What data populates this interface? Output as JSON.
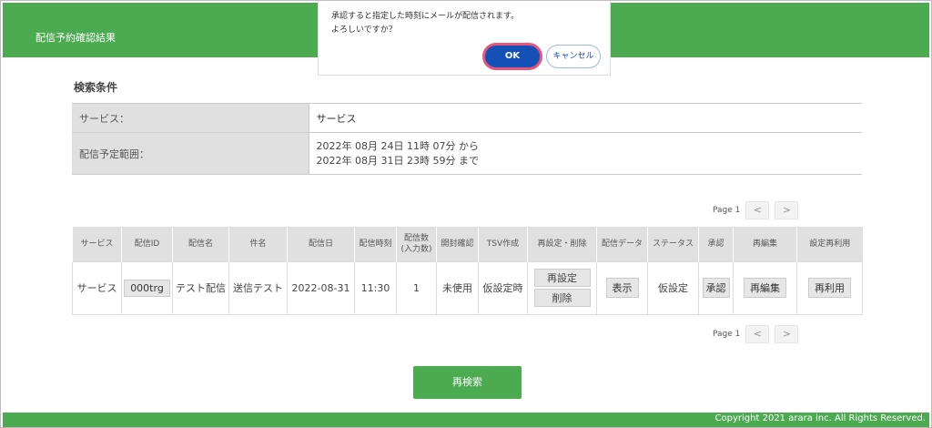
{
  "header": {
    "title": "配信予約確認結果"
  },
  "dialog": {
    "message_line1": "承認すると指定した時刻にメールが配信されます。",
    "message_line2": "よろしいですか？",
    "ok_label": "OK",
    "cancel_label": "キャンセル"
  },
  "conditions": {
    "title": "検索条件",
    "service_label": "サービス：",
    "service_value": "サービス",
    "range_label": "配信予定範囲：",
    "range_from": "2022年 08月 24日 11時 07分 から",
    "range_to": "2022年 08月 31日 23時 59分 まで"
  },
  "pager": {
    "page_label": "Page 1",
    "prev": "<",
    "next": ">"
  },
  "table": {
    "headers": [
      "サービス",
      "配信ID",
      "配信名",
      "件名",
      "配信日",
      "配信時刻",
      "配信数\n(入力数)",
      "開封確認",
      "TSV作成",
      "再設定・削除",
      "配信データ",
      "ステータス",
      "承認",
      "再編集",
      "設定再利用"
    ],
    "row": {
      "service": "サービス",
      "id": "000trg",
      "name": "テスト配信",
      "subject": "送信テスト",
      "date": "2022-08-31",
      "time": "11:30",
      "count": "1",
      "open_check": "未使用",
      "tsv": "仮設定時",
      "reset_btn": "再設定",
      "delete_btn": "削除",
      "data_btn": "表示",
      "status": "仮設定",
      "approve_btn": "承認",
      "reedit_btn": "再編集",
      "reuse_btn": "再利用"
    }
  },
  "research_label": "再検索",
  "footer": {
    "copyright": "Copyright 2021 arara inc. All Rights Reserved."
  },
  "colors": {
    "brand_green": "#4caa50",
    "ok_blue": "#1550b7",
    "highlight_pink": "#e8557a"
  }
}
